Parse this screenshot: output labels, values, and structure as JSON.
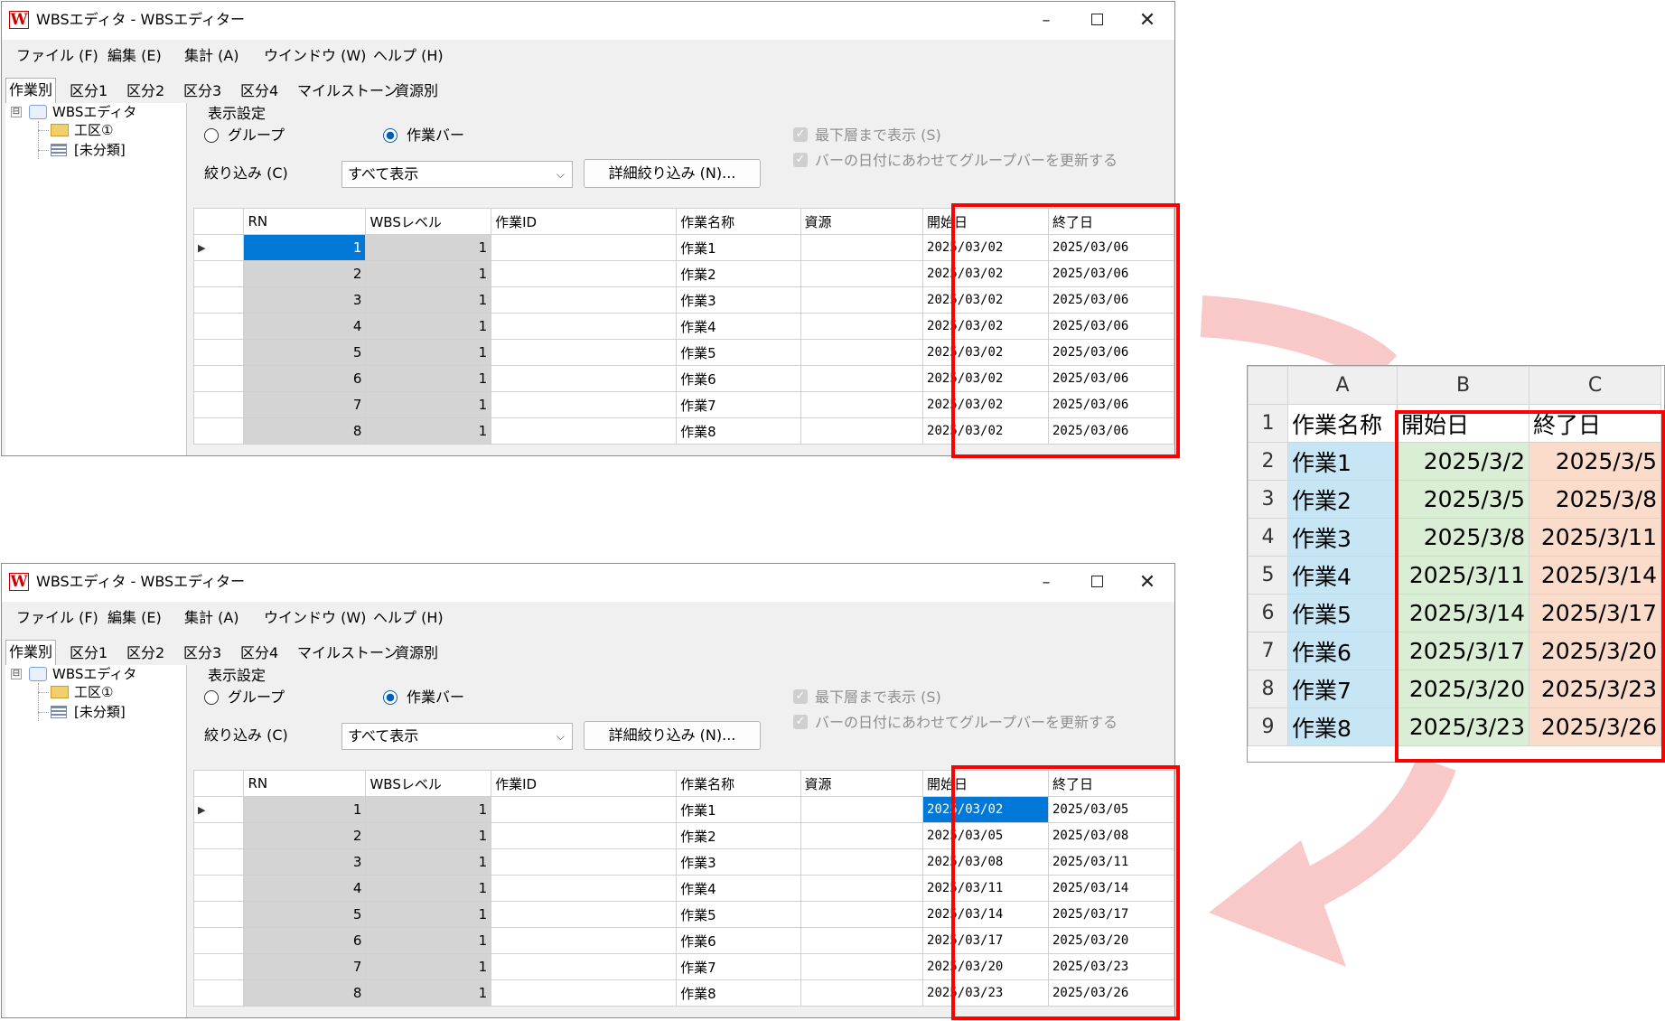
{
  "window": {
    "icon_letter": "W",
    "title": "WBSエディタ - WBSエディター",
    "controls": {
      "minimize": "–",
      "maximize": "",
      "close": "✕"
    }
  },
  "menu": [
    "ファイル (F)",
    "編集 (E)",
    "集計 (A)",
    "ウインドウ (W)",
    "ヘルプ (H)"
  ],
  "tabs": [
    "作業別",
    "区分1",
    "区分2",
    "区分3",
    "区分4",
    "マイルストーン",
    "資源別"
  ],
  "tree": {
    "root_box": "⊟",
    "root": "WBSエディタ",
    "child1": "工区①",
    "child2": "[未分類]"
  },
  "settings": {
    "group_label": "表示設定",
    "radio_group": "グループ",
    "radio_bar": "作業バー",
    "check_lowest": "最下層まで表示 (S)",
    "check_update": "バーの日付にあわせてグループバーを更新する",
    "filter_label": "絞り込み (C)",
    "filter_value": "すべて表示",
    "filter_chevron": "⌵",
    "detail_button": "詳細絞り込み (N)..."
  },
  "grid_columns": [
    "RN",
    "WBSレベル",
    "作業ID",
    "作業名称",
    "資源",
    "開始日",
    "終了日"
  ],
  "row_marker": "▶",
  "top_rows": [
    {
      "rn": "1",
      "lvl": "1",
      "name": "作業1",
      "start": "2025/03/02",
      "end": "2025/03/06"
    },
    {
      "rn": "2",
      "lvl": "1",
      "name": "作業2",
      "start": "2025/03/02",
      "end": "2025/03/06"
    },
    {
      "rn": "3",
      "lvl": "1",
      "name": "作業3",
      "start": "2025/03/02",
      "end": "2025/03/06"
    },
    {
      "rn": "4",
      "lvl": "1",
      "name": "作業4",
      "start": "2025/03/02",
      "end": "2025/03/06"
    },
    {
      "rn": "5",
      "lvl": "1",
      "name": "作業5",
      "start": "2025/03/02",
      "end": "2025/03/06"
    },
    {
      "rn": "6",
      "lvl": "1",
      "name": "作業6",
      "start": "2025/03/02",
      "end": "2025/03/06"
    },
    {
      "rn": "7",
      "lvl": "1",
      "name": "作業7",
      "start": "2025/03/02",
      "end": "2025/03/06"
    },
    {
      "rn": "8",
      "lvl": "1",
      "name": "作業8",
      "start": "2025/03/02",
      "end": "2025/03/06"
    }
  ],
  "bottom_rows": [
    {
      "rn": "1",
      "lvl": "1",
      "name": "作業1",
      "start": "2025/03/02",
      "end": "2025/03/05"
    },
    {
      "rn": "2",
      "lvl": "1",
      "name": "作業2",
      "start": "2025/03/05",
      "end": "2025/03/08"
    },
    {
      "rn": "3",
      "lvl": "1",
      "name": "作業3",
      "start": "2025/03/08",
      "end": "2025/03/11"
    },
    {
      "rn": "4",
      "lvl": "1",
      "name": "作業4",
      "start": "2025/03/11",
      "end": "2025/03/14"
    },
    {
      "rn": "5",
      "lvl": "1",
      "name": "作業5",
      "start": "2025/03/14",
      "end": "2025/03/17"
    },
    {
      "rn": "6",
      "lvl": "1",
      "name": "作業6",
      "start": "2025/03/17",
      "end": "2025/03/20"
    },
    {
      "rn": "7",
      "lvl": "1",
      "name": "作業7",
      "start": "2025/03/20",
      "end": "2025/03/23"
    },
    {
      "rn": "8",
      "lvl": "1",
      "name": "作業8",
      "start": "2025/03/23",
      "end": "2025/03/26"
    }
  ],
  "excel": {
    "col_headers": [
      "A",
      "B",
      "C"
    ],
    "header_row": [
      "作業名称",
      "開始日",
      "終了日"
    ],
    "rows": [
      [
        "作業1",
        "2025/3/2",
        "2025/3/5"
      ],
      [
        "作業2",
        "2025/3/5",
        "2025/3/8"
      ],
      [
        "作業3",
        "2025/3/8",
        "2025/3/11"
      ],
      [
        "作業4",
        "2025/3/11",
        "2025/3/14"
      ],
      [
        "作業5",
        "2025/3/14",
        "2025/3/17"
      ],
      [
        "作業6",
        "2025/3/17",
        "2025/3/20"
      ],
      [
        "作業7",
        "2025/3/20",
        "2025/3/23"
      ],
      [
        "作業8",
        "2025/3/23",
        "2025/3/26"
      ]
    ],
    "row_numbers": [
      "1",
      "2",
      "3",
      "4",
      "5",
      "6",
      "7",
      "8",
      "9"
    ]
  },
  "colors": {
    "highlight_red": "#ff0000",
    "arrow_pink": "#f9c9c9",
    "selection_blue": "#0078d7",
    "excel_a": "#c6e6f5",
    "excel_b": "#d9eed4",
    "excel_c": "#fbdccb"
  }
}
